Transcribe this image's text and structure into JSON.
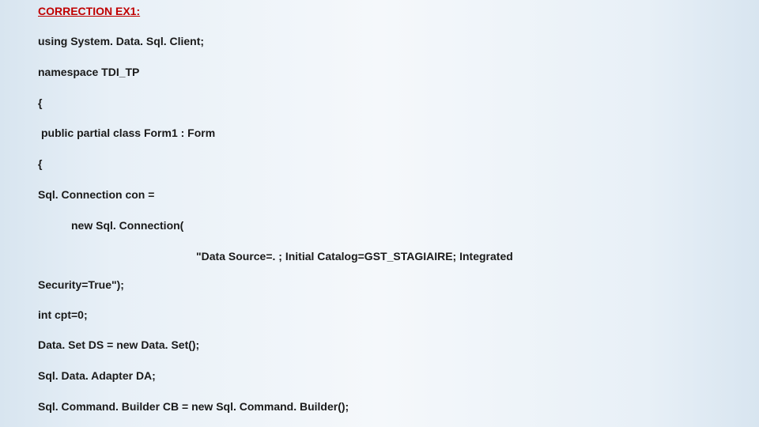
{
  "heading": "CORRECTION EX1:",
  "lines": {
    "using": "using System. Data. Sql. Client;",
    "namespace": "namespace TDI_TP",
    "open_brace": "{",
    "class_decl": "public partial class Form1 : Form",
    "open_brace_2": "{",
    "sql_conn": "Sql. Connection con =",
    "new_conn": "new Sql. Connection(",
    "conn_string_right": "\"Data Source=. ; Initial Catalog=GST_STAGIAIRE; Integrated",
    "conn_string_left": "Security=True\");",
    "intcpt": "int cpt=0;",
    "dataset": "Data. Set DS = new Data. Set();",
    "adapter": "Sql. Data. Adapter DA;",
    "cmd_builder": "Sql. Command. Builder CB = new Sql. Command. Builder();"
  }
}
